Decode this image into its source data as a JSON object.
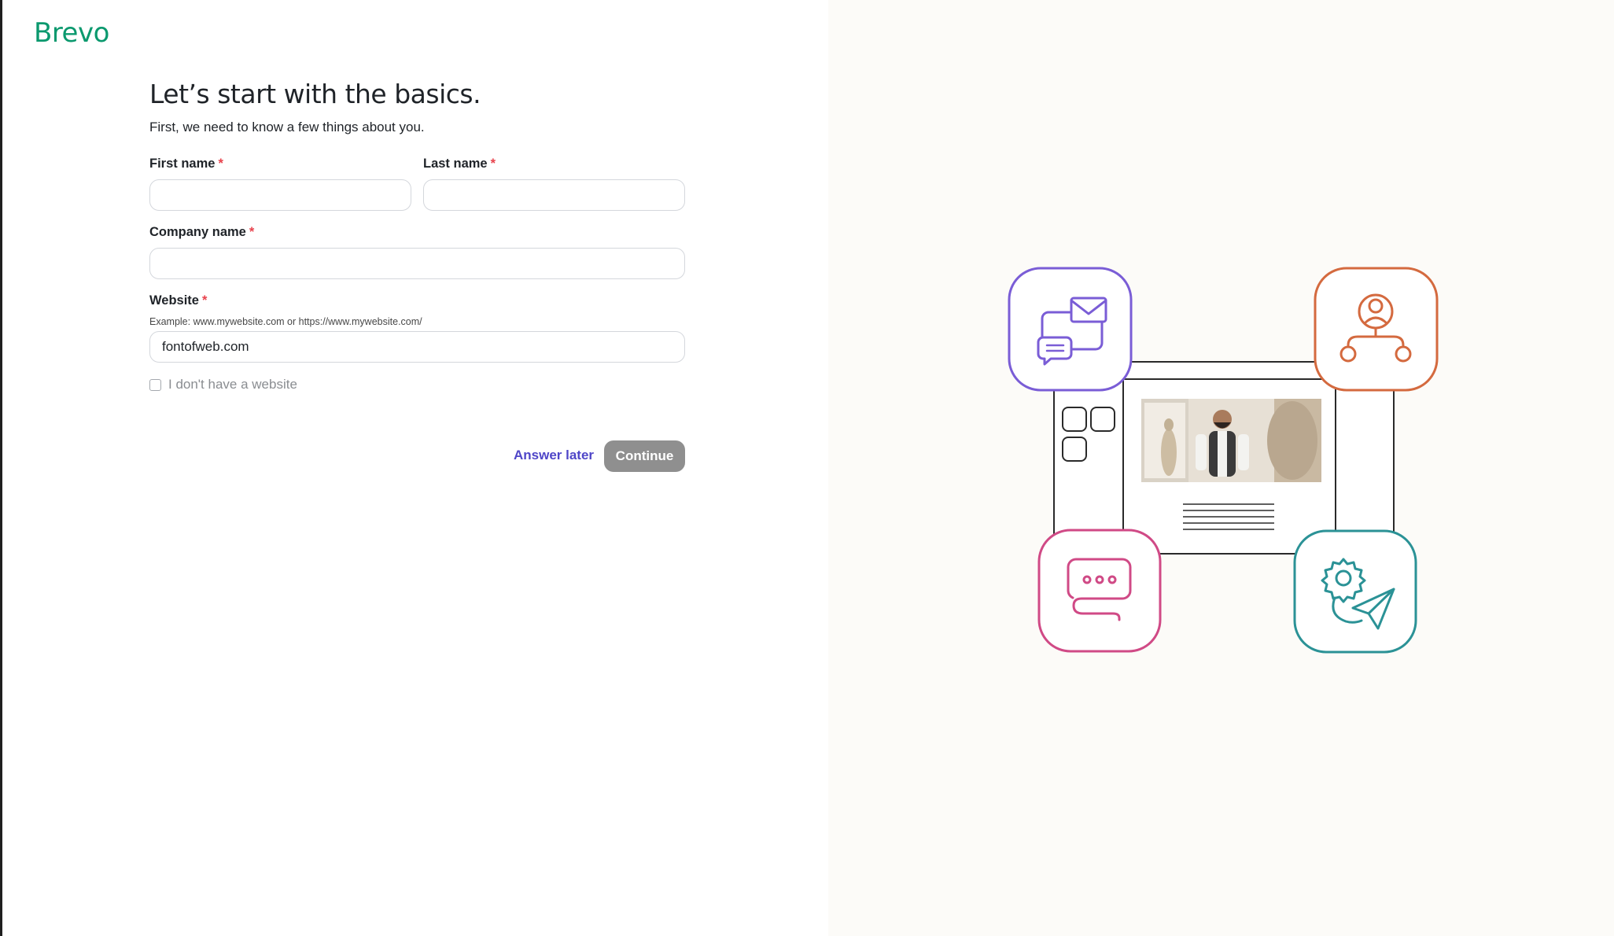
{
  "brand": {
    "logo_text": "Brevo",
    "color": "#0b996e"
  },
  "form": {
    "title": "Let’s start with the basics.",
    "subtitle": "First, we need to know a few things about you.",
    "required_marker": "*",
    "first_name": {
      "label": "First name",
      "value": ""
    },
    "last_name": {
      "label": "Last name",
      "value": ""
    },
    "company_name": {
      "label": "Company name",
      "value": ""
    },
    "website": {
      "label": "Website",
      "hint": "Example: www.mywebsite.com or https://www.mywebsite.com/",
      "value": "fontofweb.com"
    },
    "no_website_checkbox": {
      "label": "I don't have a website",
      "checked": false
    },
    "answer_later_label": "Answer later",
    "continue_label": "Continue"
  },
  "illustration": {
    "icons": [
      "chat-mail-icon",
      "contacts-network-icon",
      "message-bubble-icon",
      "settings-send-icon"
    ],
    "colors": {
      "purple": "#7a5dd6",
      "orange": "#d46a3f",
      "pink": "#d04a86",
      "teal": "#2b9296"
    }
  }
}
